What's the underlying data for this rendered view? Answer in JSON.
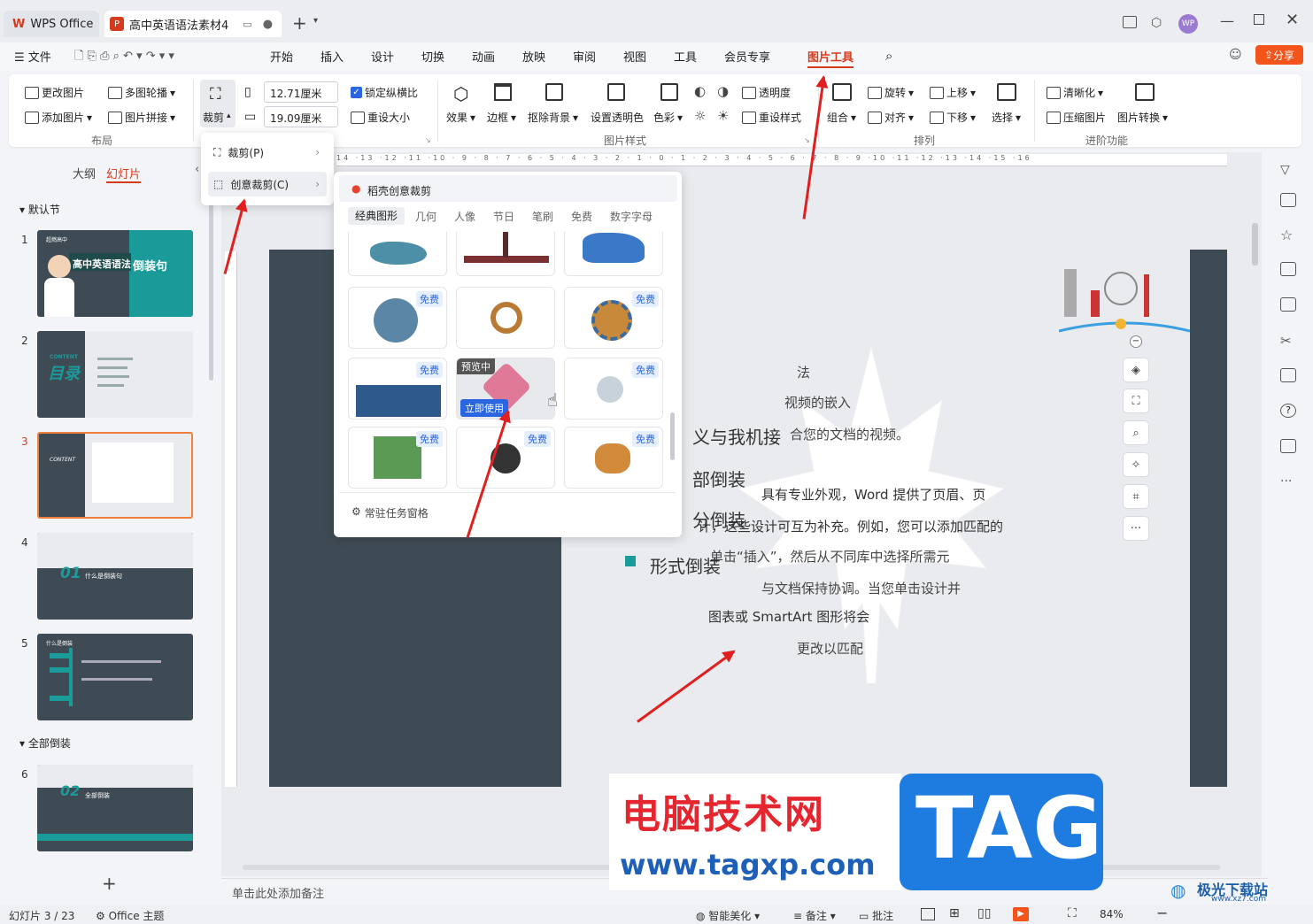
{
  "titlebar": {
    "app_tab": "WPS Office",
    "doc_tab": "高中英语语法素材4",
    "new_tab": "+"
  },
  "menu": {
    "file": "文件",
    "items": [
      "开始",
      "插入",
      "设计",
      "切换",
      "动画",
      "放映",
      "审阅",
      "视图",
      "工具",
      "会员专享"
    ],
    "picture_tools": "图片工具",
    "share": "分享"
  },
  "ribbon": {
    "change_pic": "更改图片",
    "add_pic": "添加图片",
    "multi_carousel": "多图轮播",
    "pic_collage": "图片拼接",
    "layout_group": "布局",
    "crop": "裁剪",
    "width": "12.71厘米",
    "height": "19.09厘米",
    "lock_ratio": "锁定纵横比",
    "reset_size": "重设大小",
    "effects": "效果",
    "border": "边框",
    "remove_bg": "抠除背景",
    "set_transparent": "设置透明色",
    "color": "色彩",
    "transparency": "透明度",
    "reset_style": "重设样式",
    "pic_style_group": "图片样式",
    "group_btn": "组合",
    "rotate": "旋转",
    "align": "对齐",
    "up": "上移",
    "down": "下移",
    "select": "选择",
    "arrange_group": "排列",
    "sharpen": "清晰化",
    "compress": "压缩图片",
    "convert": "图片转换",
    "advanced_group": "进阶功能"
  },
  "crop_menu": {
    "crop": "裁剪(P)",
    "creative": "创意裁剪(C)"
  },
  "creative_panel": {
    "title": "稻壳创意裁剪",
    "tabs": [
      "经典图形",
      "几何",
      "人像",
      "节日",
      "笔刷",
      "免费",
      "数字字母"
    ],
    "free": "免费",
    "previewing": "预览中",
    "use_now": "立即使用",
    "pin": "常驻任务窗格"
  },
  "left": {
    "tab_outline": "大纲",
    "tab_slides": "幻灯片",
    "section1": "默认节",
    "section2": "全部倒装",
    "nums": [
      "1",
      "2",
      "3",
      "4",
      "5",
      "6"
    ],
    "add": "+",
    "t1_title": "高中英语语法",
    "t1_sub": "倒装句",
    "t1_tag": "超燃高中",
    "t2_title": "目录",
    "t2_en": "CONTENT",
    "t3_en": "CONTENT",
    "t4_num": "01",
    "t4_txt": "什么是倒装句",
    "t5_title": "什么是倒装",
    "t6_num": "02",
    "t6_txt": "全部倒装"
  },
  "slide": {
    "line1": "法",
    "line2": "视频的嵌入",
    "line3": "义与我机接",
    "line4": "合您的文档的视频。",
    "line5": "部倒装",
    "line6": "具有专业外观，Word 提供了页眉、页",
    "line7": "分倒装",
    "line8": "计，这些设计可互为补充。例如，您可以添加匹配的",
    "line9": "单击“插入”，然后从不同库中选择所需元",
    "line10": "形式倒装",
    "line11": "与文档保持协调。当您单击设计并",
    "line12": "图表或 SmartArt 图形将会",
    "line13": "更改以匹配"
  },
  "notes": "单击此处添加备注",
  "status": {
    "slide_count": "幻灯片 3 / 23",
    "theme": "Office 主题",
    "beautify": "智能美化",
    "notes": "备注",
    "comment": "批注",
    "zoom": "84%"
  },
  "watermark": {
    "cn": "电脑技术网",
    "url": "www.tagxp.com",
    "tag": "TAG",
    "logo": "极光下载站",
    "logo_url": "www.xz7.com"
  },
  "colors": {
    "accent": "#d63a1d",
    "teal": "#1b9a9a",
    "dark": "#3f4b54",
    "arrow": "#e02020",
    "blue": "#2a66e0"
  }
}
